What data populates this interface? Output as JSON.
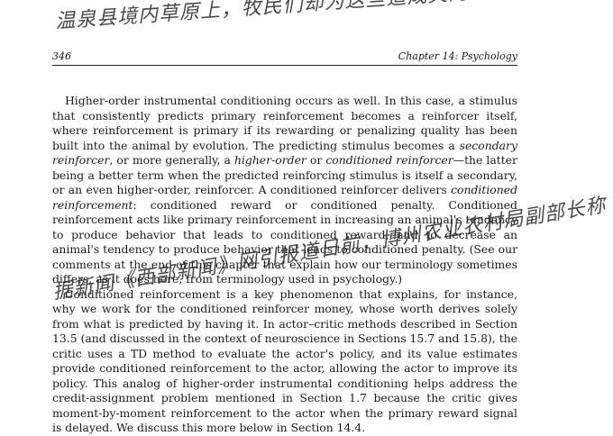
{
  "header": {
    "page_number": "346",
    "chapter": "Chapter 14: Psychology"
  },
  "paragraphs": [
    {
      "segments": [
        {
          "text": "Higher-order instrumental conditioning occurs as well. In this case, a stimulus that consistently predicts primary reinforcement becomes a reinforcer itself, where reinforcement is primary if its rewarding or penalizing quality has been built into the animal by evolution. The predicting stimulus becomes a ",
          "italic": false
        },
        {
          "text": "secondary reinforcer",
          "italic": true
        },
        {
          "text": ", or more generally, a ",
          "italic": false
        },
        {
          "text": "higher-order",
          "italic": true
        },
        {
          "text": " or ",
          "italic": false
        },
        {
          "text": "conditioned reinforcer",
          "italic": true
        },
        {
          "text": "—the latter being a better term when the predicted reinforcing stimulus is itself a secondary, or an even higher-order, reinforcer. A conditioned reinforcer delivers ",
          "italic": false
        },
        {
          "text": "conditioned reinforcement",
          "italic": true
        },
        {
          "text": ": conditioned reward or conditioned penalty. Conditioned reinforcement acts like primary reinforcement in increasing an animal's tendency to produce behavior that leads to conditioned reward, and to decrease an animal's tendency to produce behavior that leads to conditioned penalty. (See our comments at the end of this chapter that explain how our terminology sometimes differs, as it does here, from terminology used in psychology.)",
          "italic": false
        }
      ]
    },
    {
      "segments": [
        {
          "text": "Conditioned reinforcement is a key phenomenon that explains, for instance, why we work for the conditioned reinforcer money, whose worth derives solely from what is predicted by having it. In actor–critic methods described in Section 13.5 (and discussed in the context of neuroscience in Sections 15.7 and 15.8), the critic uses a TD method to evaluate the actor's policy, and its value estimates provide conditioned reinforcement to the actor, allowing the actor to improve its policy. This analog of higher-order instrumental conditioning helps address the credit-assignment problem mentioned in Section 1.7 because the critic gives moment-by-moment reinforcement to the actor when the primary reward signal is delayed. We discuss this more below in Section 14.4.",
          "italic": false
        }
      ]
    }
  ],
  "handwriting": {
    "top": "温泉县境内草原上，牧民们却为这些造成灾的旱獭与鼠害",
    "middle": "据新闻《西部新闻》网引报道日前，博州农业农村局副部长称"
  }
}
